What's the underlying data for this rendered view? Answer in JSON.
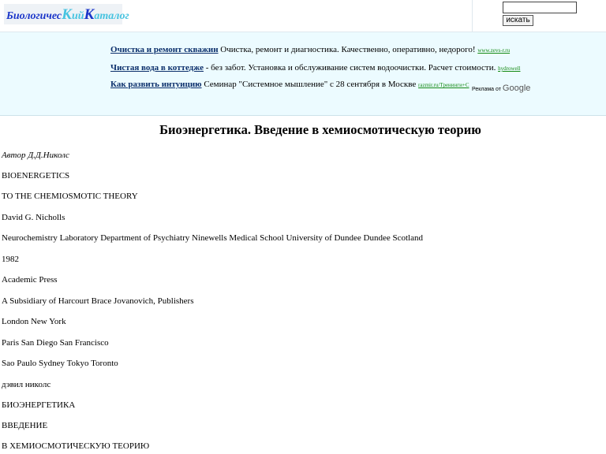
{
  "header": {
    "logo": {
      "part1": "Биологичес",
      "part2": "К",
      "part3": "ий",
      "part4": "К",
      "part5": "аталог"
    },
    "search": {
      "placeholder": "",
      "button_label": "искать"
    }
  },
  "ads": [
    {
      "title": "Очистка и ремонт скважин",
      "text": " Очистка, ремонт и диагностика. Качественно, оперативно, недорого!",
      "url": "www.zevs-r.ru"
    },
    {
      "title": "Чистая вода в коттедже",
      "text": " - без забот. Установка и обслуживание систем водоочистки. Расчет стоимости.",
      "url": "hydrowell"
    },
    {
      "title": "Как развить интуицию",
      "text": " Семинар \"Системное мышление\" с 28 сентября в Москве",
      "url": "razmir.ru/Тренинги+С"
    }
  ],
  "adsense": {
    "prefix": "Реклама от ",
    "brand": "Google"
  },
  "article": {
    "title": "Биоэнергетика. Введение в хемиосмотическую теорию",
    "author": "Автор Д.Д.Николс",
    "lines": [
      "BIOENERGETICS",
      "TO THE CHEMIOSMOTIC THEORY",
      "David G. Nicholls",
      "Neurochemistry Laboratory Department of Psychiatry Ninewells Medical School University of Dundee Dundee Scotland",
      "1982",
      "Academic Press",
      "A Subsidiary of Harcourt Brace Jovanovich, Publishers",
      "London New York",
      "Paris San Diego San Francisco",
      "Sao Paulo Sydney Tokyo Toronto",
      "дэвил николс",
      "БИОЭНЕРГЕТИКА",
      "ВВЕДЕНИЕ",
      "В ХЕМИОСМОТИЧЕСКУЮ ТЕОРИЮ"
    ]
  }
}
